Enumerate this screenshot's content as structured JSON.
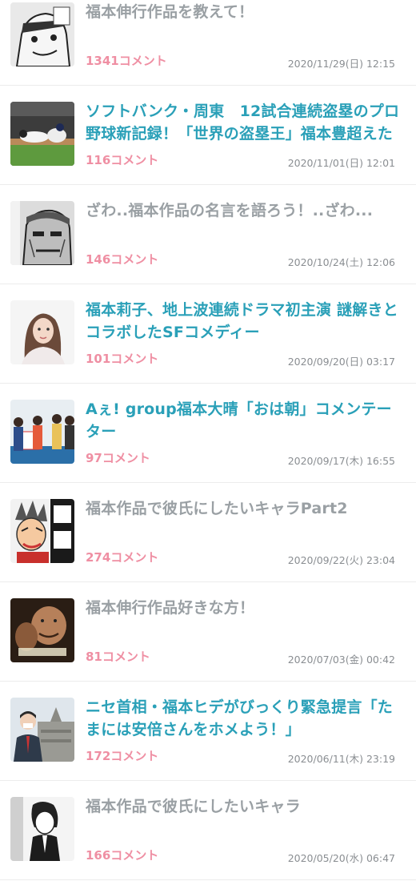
{
  "articles": [
    {
      "title": "福本伸行作品を教えて！",
      "comments": "1341コメント",
      "date": "2020/11/29(日) 12:15",
      "read": true,
      "thumb": "manga-face-icon"
    },
    {
      "title": "ソフトバンク・周東　12試合連続盗塁のプロ野球新記録！「世界の盗塁王」福本豊超えた",
      "comments": "116コメント",
      "date": "2020/11/01(日) 12:01",
      "read": false,
      "thumb": "baseball-photo-icon"
    },
    {
      "title": "ざわ..福本作品の名言を語ろう！..ざわ...",
      "comments": "146コメント",
      "date": "2020/10/24(土) 12:06",
      "read": true,
      "thumb": "manga-man-icon"
    },
    {
      "title": "福本莉子、地上波連続ドラマ初主演 謎解きとコラボしたSFコメディー",
      "comments": "101コメント",
      "date": "2020/09/20(日) 03:17",
      "read": false,
      "thumb": "portrait-photo-icon"
    },
    {
      "title": "Aぇ! group福本大晴「おは朝」コメンテーター",
      "comments": "97コメント",
      "date": "2020/09/17(木) 16:55",
      "read": false,
      "thumb": "group-photo-icon"
    },
    {
      "title": "福本作品で彼氏にしたいキャラPart2",
      "comments": "274コメント",
      "date": "2020/09/22(火) 23:04",
      "read": true,
      "thumb": "manga-cover-icon"
    },
    {
      "title": "福本伸行作品好きな方！",
      "comments": "81コメント",
      "date": "2020/07/03(金) 00:42",
      "read": true,
      "thumb": "tv-photo-icon"
    },
    {
      "title": "ニセ首相・福本ヒデがびっくり緊急提言「たまには安倍さんをホメよう！」",
      "comments": "172コメント",
      "date": "2020/06/11(木) 23:19",
      "read": false,
      "thumb": "diet-building-photo-icon"
    },
    {
      "title": "福本作品で彼氏にしたいキャラ",
      "comments": "166コメント",
      "date": "2020/05/20(水) 06:47",
      "read": true,
      "thumb": "manga-suit-icon"
    }
  ]
}
